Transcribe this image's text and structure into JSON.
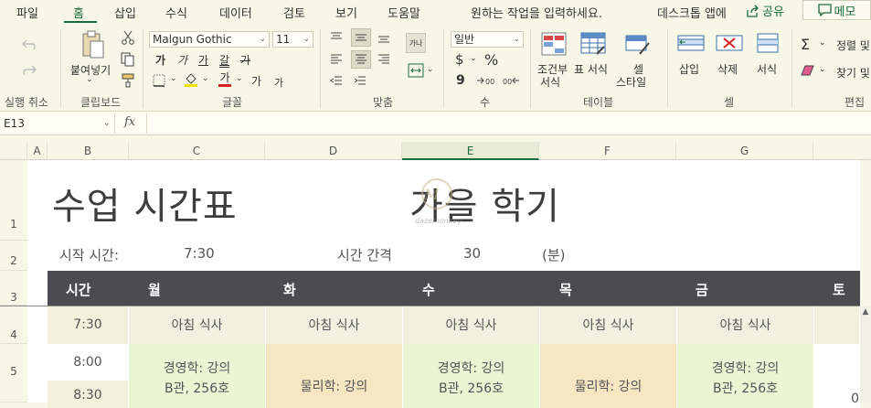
{
  "menu": {
    "tabs": [
      "파일",
      "홈",
      "삽입",
      "수식",
      "데이터",
      "검토",
      "보기",
      "도움말"
    ],
    "tell_me": "원하는 작업을 입력하세요.",
    "signin": "데스크톱 앱에",
    "share": "공유",
    "memo": "메모"
  },
  "ribbon": {
    "undo_group": "실행 취소",
    "clipboard": {
      "paste": "붙여넣기",
      "label": "클립보드"
    },
    "font": {
      "name": "Malgun Gothic",
      "size": "11",
      "label": "글꼴",
      "bold": "가",
      "italic": "가",
      "underline": "가",
      "double_underline": "갈",
      "strike": "가",
      "font_color_glyph": "가",
      "grow": "가",
      "shrink": "가"
    },
    "align": {
      "label": "맞춤",
      "wrap": "가나"
    },
    "number": {
      "format": "일반",
      "label": "수",
      "currency": "$",
      "percent": "%",
      "comma": "9"
    },
    "table": {
      "conditional_1": "조건부",
      "conditional_2": "서식",
      "format_table_1": "표 서식",
      "cell_style_1": "셀",
      "cell_style_2": "스타일",
      "label": "테이블"
    },
    "cells": {
      "insert": "삽입",
      "delete": "삭제",
      "format": "서식",
      "label": "셀"
    },
    "edit": {
      "sum": "Σ",
      "sort": "정렬 및",
      "find": "찾기 및",
      "label": "편집"
    }
  },
  "formula_bar": {
    "name_box": "E13",
    "fx": "fx",
    "value": ""
  },
  "columns": [
    "A",
    "B",
    "C",
    "D",
    "E",
    "F",
    "G"
  ],
  "rows": [
    "1",
    "2",
    "3",
    "4",
    "5"
  ],
  "sheet": {
    "title": "수업 시간표",
    "term": "가을 학기",
    "start_label": "시작 시간:",
    "start_value": "7:30",
    "interval_label": "시간 간격",
    "interval_value": "30",
    "interval_unit": "(분)",
    "header": [
      "시간",
      "월",
      "화",
      "수",
      "목",
      "금",
      "토"
    ],
    "rows": [
      {
        "time": "7:30",
        "cells": [
          "아침 식사",
          "아침 식사",
          "아침 식사",
          "아침 식사",
          "아침 식사"
        ]
      },
      {
        "time": "8:00",
        "time2": "8:30",
        "cells": [
          {
            "line1": "경영학: 강의",
            "line2": "B관, 256호"
          },
          {
            "line1": "물리학: 강의",
            "line2": ""
          },
          {
            "line1": "경영학: 강의",
            "line2": "B관, 256호"
          },
          {
            "line1": "물리학: 강의",
            "line2": ""
          },
          {
            "line1": "경영학: 강의",
            "line2": "B관, 256호"
          }
        ]
      }
    ],
    "saturday_fragment": "0"
  },
  "watermark": "dazemonkey",
  "colors": {
    "accent": "#1e6b3a",
    "header_bg": "#4b4b50",
    "mgmt": "#e9f5d3",
    "phys": "#f6e6c2",
    "meal": "#f1f1df"
  }
}
